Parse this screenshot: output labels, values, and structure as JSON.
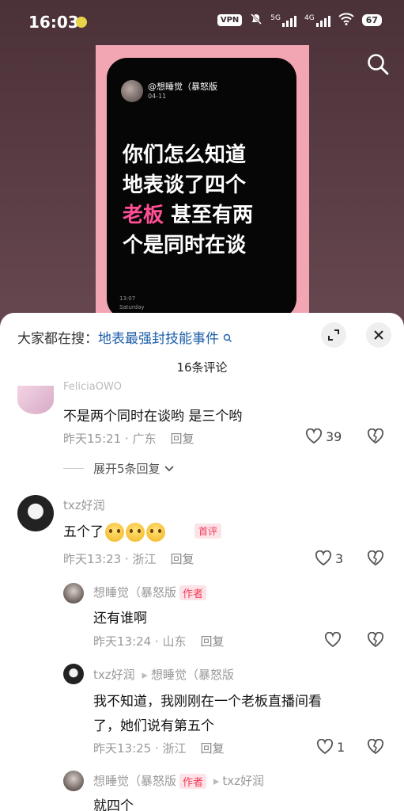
{
  "status": {
    "time": "16:03",
    "vpn": "VPN",
    "sig1": "5G",
    "sig2": "4G",
    "battery": "67"
  },
  "video": {
    "handle": "@想睡觉（暴怒版",
    "date": "04-11",
    "line1": "你们怎么知道",
    "line2": "地表谈了四个",
    "line3_pink": "老板",
    "line3_rest": " 甚至有两",
    "line4": "个是同时在谈",
    "ts_time": "13:07",
    "ts_day": "Saturday"
  },
  "sheet": {
    "trend_prefix": "大家都在搜：",
    "trend_link": "地表最强封技能事件",
    "count_label": "16条评论"
  },
  "comments": [
    {
      "name": "FeliciaOWO",
      "text": "不是两个同时在谈哟 是三个哟",
      "meta": "昨天15:21 · 广东",
      "reply": "回复",
      "likes": "39",
      "expand": "展开5条回复"
    },
    {
      "name": "txz好润",
      "text": "五个了",
      "badge": "首评",
      "meta": "昨天13:23 · 浙江",
      "reply": "回复",
      "likes": "3"
    },
    {
      "name": "想睡觉（暴怒版",
      "author_tag": "作者",
      "text": "还有谁啊",
      "meta": "昨天13:24 · 山东",
      "reply": "回复",
      "likes": ""
    },
    {
      "name": "txz好润",
      "arrow": "▸",
      "reply_to": "想睡觉（暴怒版",
      "text1": "我不知道，我刚刚在一个老板直播间看",
      "text2": "了，她们说有第五个",
      "meta": "昨天13:25 · 浙江",
      "reply": "回复",
      "likes": "1"
    },
    {
      "name": "想睡觉（暴怒版",
      "author_tag": "作者",
      "arrow": "▸",
      "reply_to": "txz好润",
      "text": "就四个"
    }
  ]
}
